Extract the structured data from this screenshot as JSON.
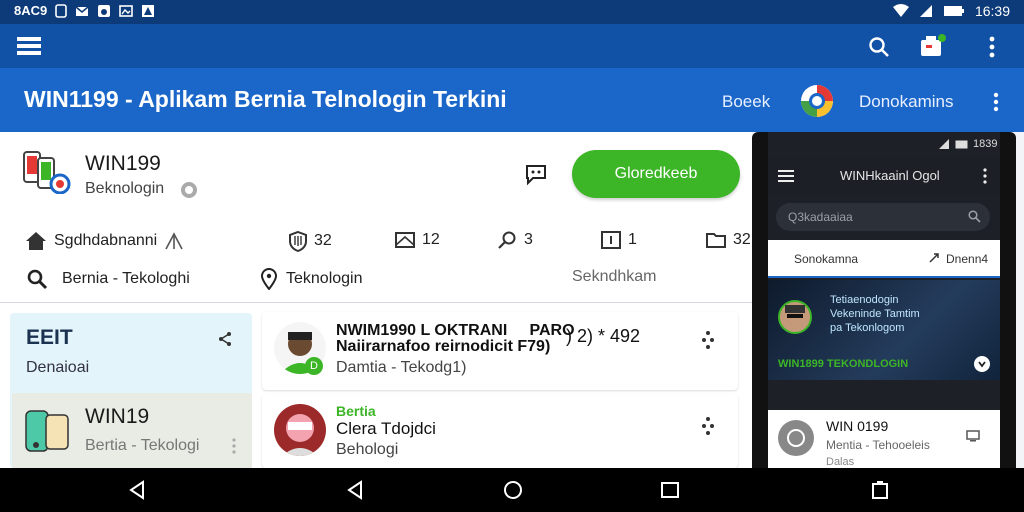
{
  "status_bar": {
    "left_text": "8AC9",
    "time": "16:39",
    "icons": [
      "sim-icon",
      "mail-icon",
      "android-icon",
      "image-icon",
      "alert-icon",
      "wifi-icon",
      "signal-icon",
      "battery-icon"
    ]
  },
  "toolbar": {
    "icons": [
      "menu-icon",
      "search-icon",
      "notification-icon",
      "more-vert-icon"
    ]
  },
  "title_bar": {
    "title": "WIN1199 - Aplikam Bernia Telnologin Terkini",
    "link1": "Boeek",
    "link2": "Donokamins"
  },
  "app_header": {
    "name": "WIN199",
    "subtitle": "Beknologin",
    "primary_button": "Gloredkeeb"
  },
  "stats_row": {
    "home_label": "Sgdhdabnanni",
    "stat1": "32",
    "stat2": "12",
    "stat3": "3",
    "stat4": "1",
    "stat5": "32"
  },
  "filter_row": {
    "search_label": "Bernia - Tekologhi",
    "location_label": "Teknologin",
    "right_label": "Sekndhkam"
  },
  "left_panel": {
    "title": "EEIT",
    "subtitle": "Denaioai",
    "card_title": "WIN19",
    "card_sub": "Bertia - Tekologi"
  },
  "list": [
    {
      "title_line1": "NWIM1990 L OKTRANI     PARO",
      "title_line2": "Naiirarnafoo reirnodicit F79)",
      "suffix": ") 2) * 492",
      "subtitle": "Damtia - Tekodg1)"
    },
    {
      "title_highlight": "Bertia",
      "title_line2": "Clera Tdojdci",
      "subtitle": "Behologi"
    }
  ],
  "phone": {
    "time": "1839",
    "app_title": "WINHkaainl Ogol",
    "search_placeholder": "Q3kadaaiaa",
    "tab_left": "Sonokamna",
    "tab_right": "Dnenn4",
    "promo_lines": [
      "Tetiaenodogin",
      "Vekeninde Tamtim",
      "pa Tekonlogom"
    ],
    "promo_green": "WIN1899 TEKONDLOGIN",
    "card_title": "WIN 0199",
    "card_sub": "Mentia - Tehooeleis",
    "card_sub2": "Dalas"
  },
  "colors": {
    "status_bar": "#0d3a78",
    "toolbar": "#1152a6",
    "title_bar": "#1a66c9",
    "primary_button": "#3cb527",
    "highlight_green": "#3cb527"
  }
}
